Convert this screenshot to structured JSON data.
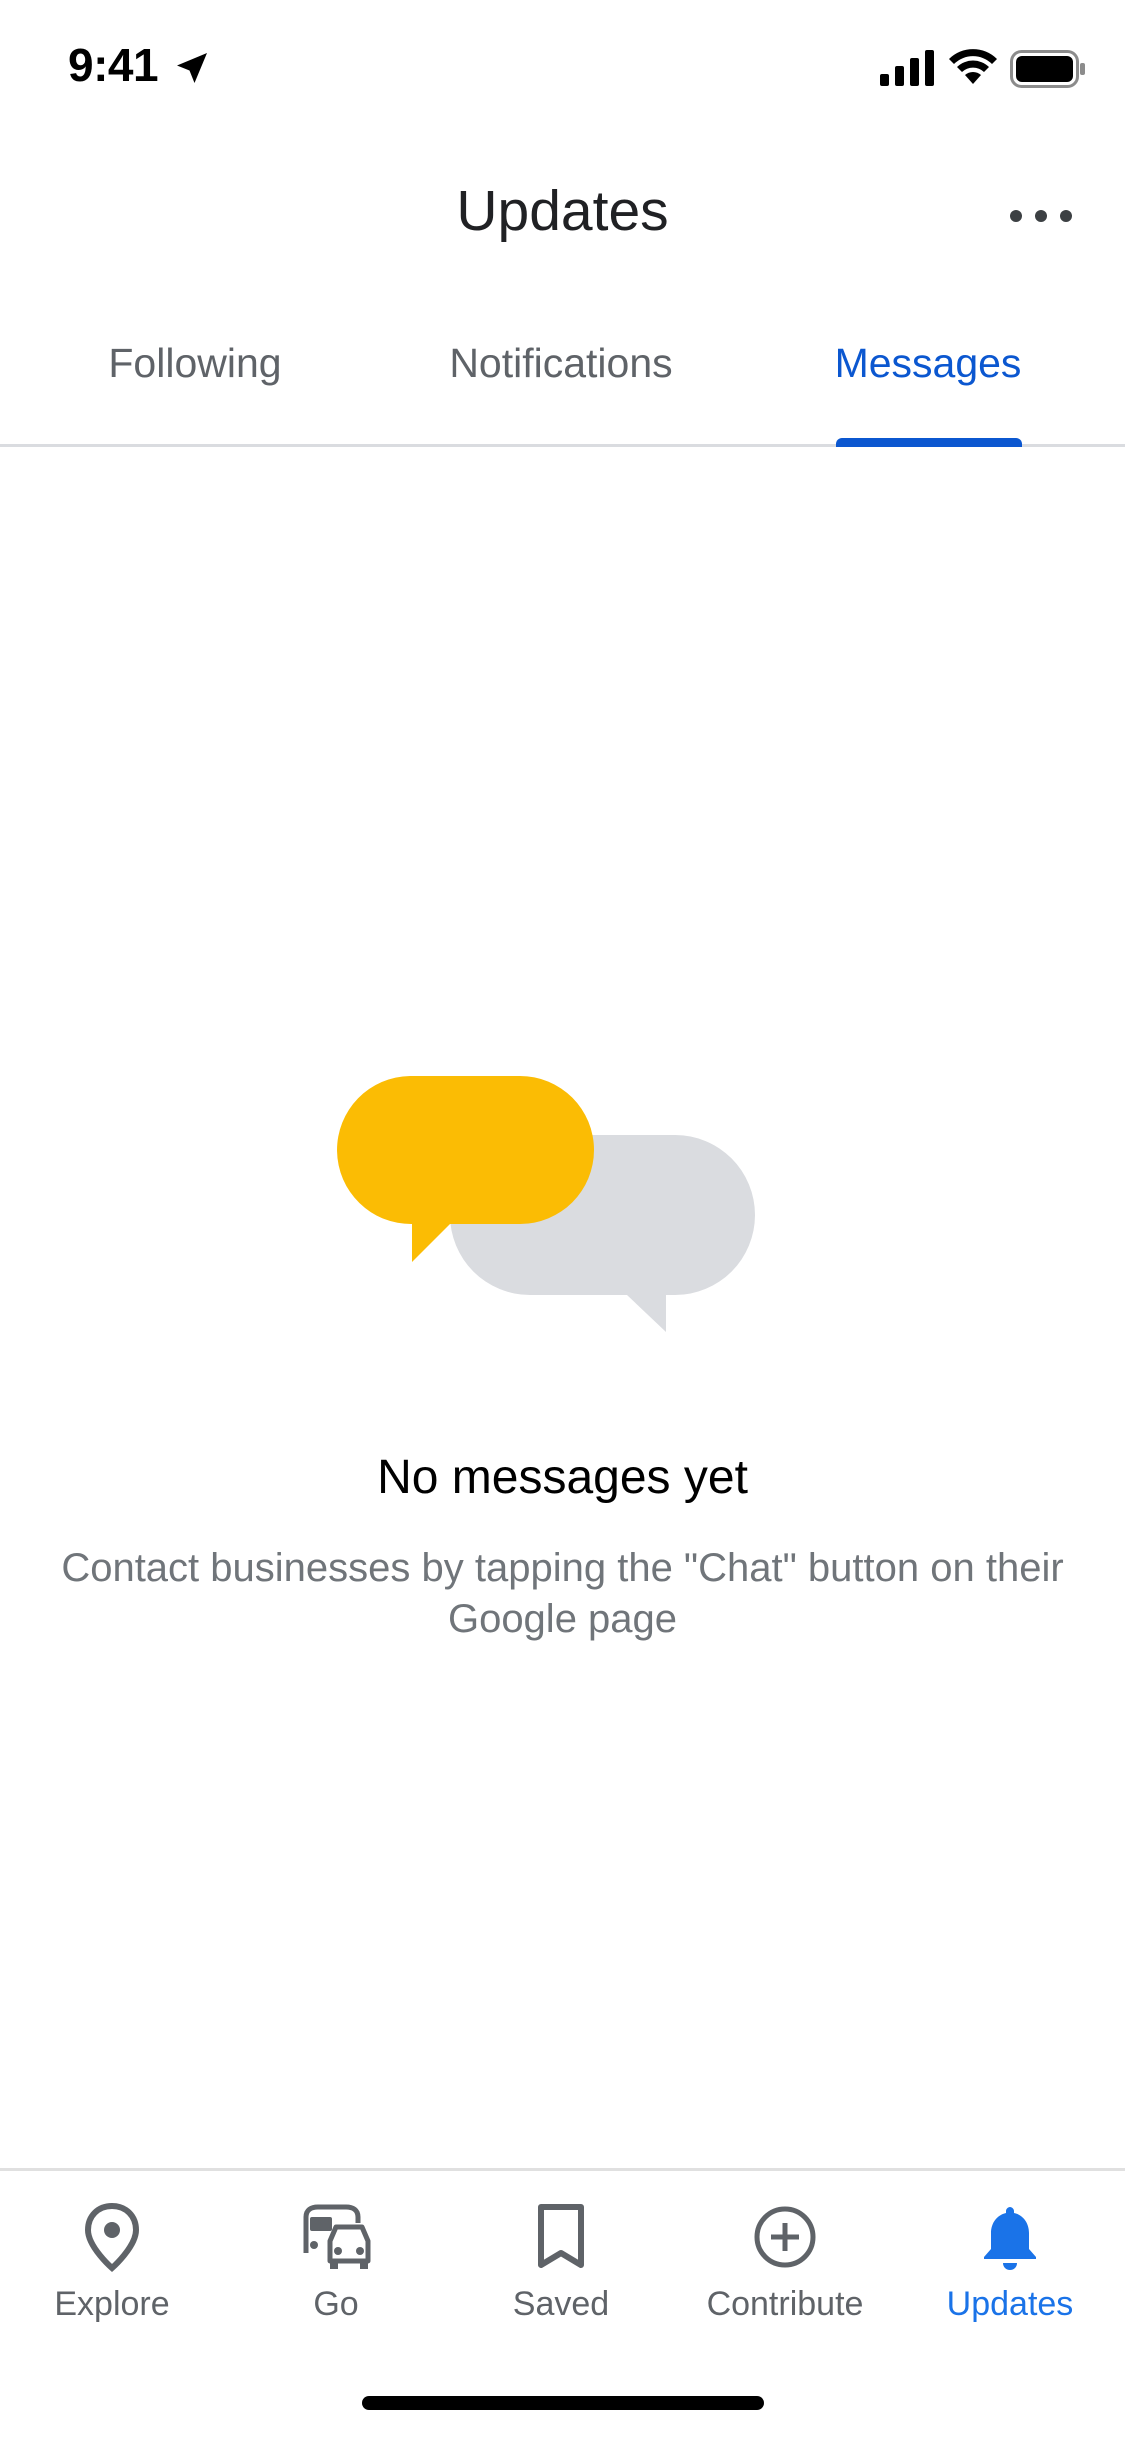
{
  "status_bar": {
    "time": "9:41",
    "icons": [
      "location-arrow-icon",
      "cellular-signal-icon",
      "wifi-icon",
      "battery-icon"
    ]
  },
  "header": {
    "title": "Updates",
    "more_icon": "more-horizontal-icon"
  },
  "tabs": [
    {
      "label": "Following",
      "active": false
    },
    {
      "label": "Notifications",
      "active": false
    },
    {
      "label": "Messages",
      "active": true
    }
  ],
  "empty_state": {
    "illustration": "chat-bubbles-illustration",
    "title": "No messages yet",
    "description": "Contact businesses by tapping the \"Chat\" button on their Google page"
  },
  "bottom_nav": [
    {
      "label": "Explore",
      "icon": "location-pin-icon",
      "active": false
    },
    {
      "label": "Go",
      "icon": "commute-icon",
      "active": false
    },
    {
      "label": "Saved",
      "icon": "bookmark-icon",
      "active": false
    },
    {
      "label": "Contribute",
      "icon": "add-circle-icon",
      "active": false
    },
    {
      "label": "Updates",
      "icon": "bell-icon",
      "active": true
    }
  ],
  "colors": {
    "accent": "#0b57d0",
    "nav_active": "#1a73e8",
    "bubble_yellow": "#fbbc04",
    "bubble_gray": "#dadce0",
    "muted_text": "#70757a"
  }
}
